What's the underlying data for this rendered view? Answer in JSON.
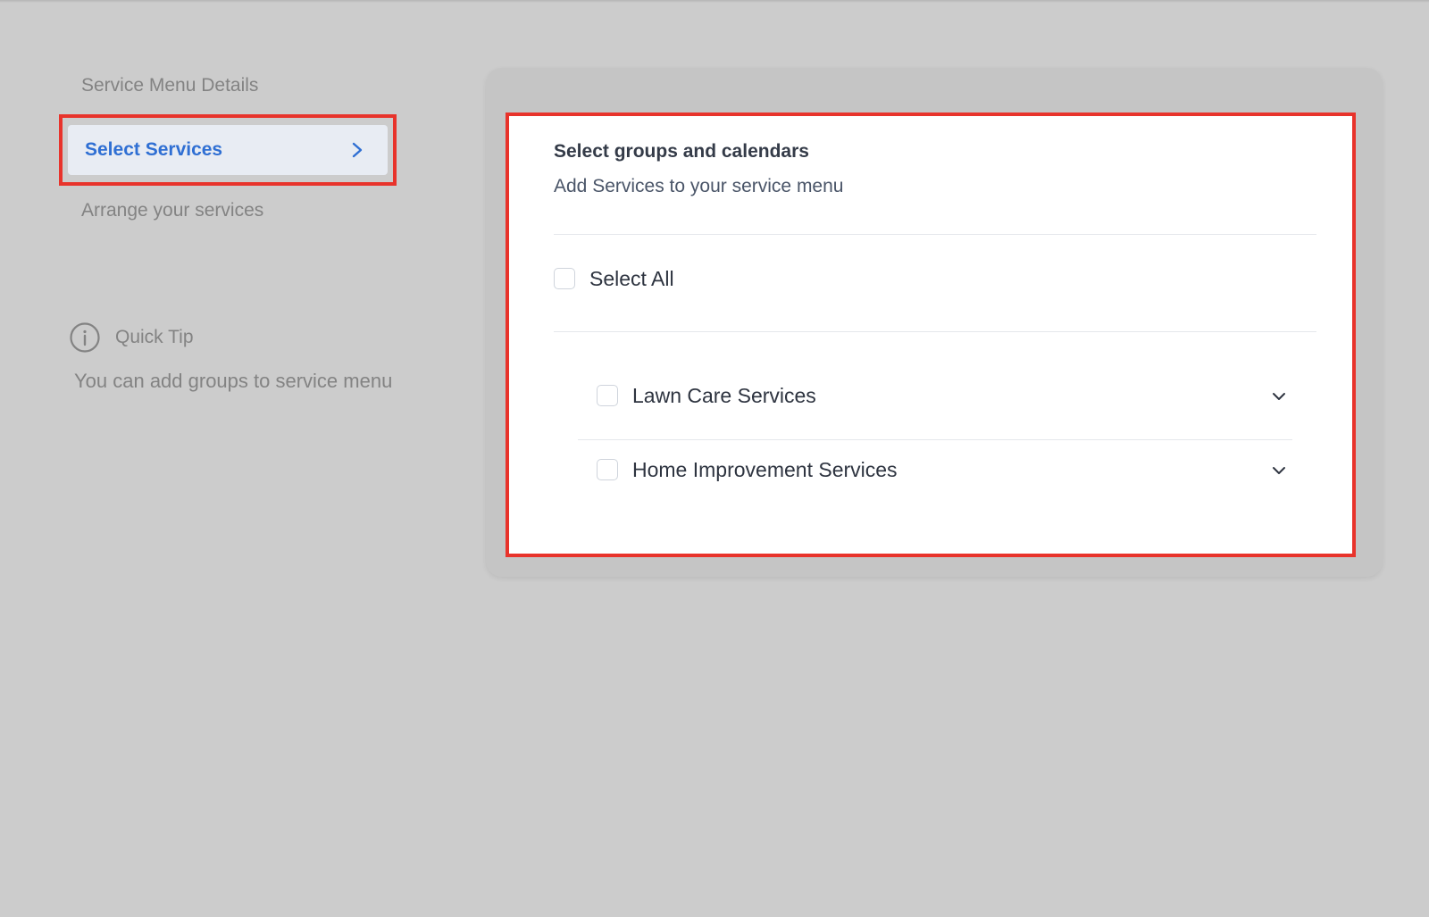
{
  "stepper": {
    "steps": [
      {
        "label": "Service Menu Details"
      },
      {
        "label": "Select Services",
        "active": true
      },
      {
        "label": "Arrange your services"
      }
    ]
  },
  "quick_tip": {
    "title": "Quick Tip",
    "body": "You can add groups to service menu",
    "icon": "info-icon"
  },
  "panel": {
    "title": "Select groups and calendars",
    "subtitle": "Add Services to your service menu",
    "select_all_label": "Select All",
    "select_all_checked": false,
    "groups": [
      {
        "label": "Lawn Care Services",
        "checked": false,
        "expanded": false
      },
      {
        "label": "Home Improvement Services",
        "checked": false,
        "expanded": false
      }
    ]
  },
  "colors": {
    "background": "#cccccc",
    "accent": "#2f6fd3",
    "highlight": "#e8332b",
    "muted_text": "#838383"
  }
}
